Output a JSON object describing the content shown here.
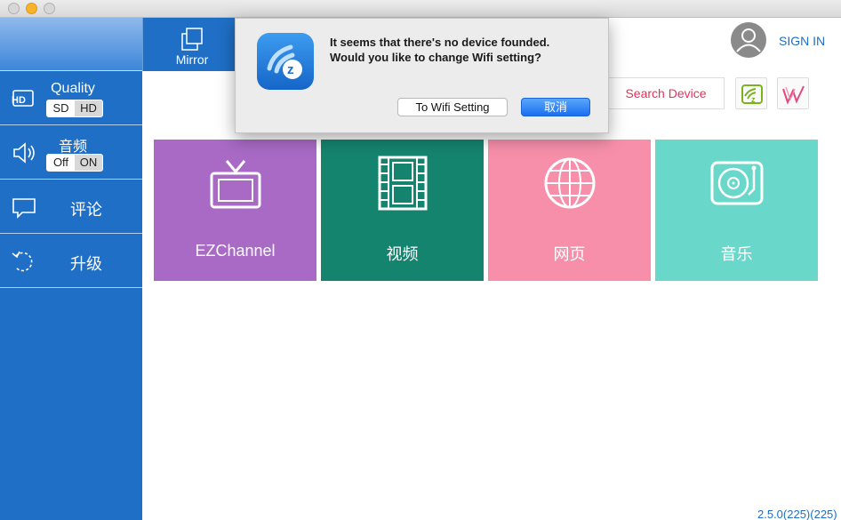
{
  "sidebar": {
    "quality": {
      "title": "Quality",
      "options": [
        "SD",
        "HD"
      ],
      "selected": "HD"
    },
    "audio": {
      "title": "音频",
      "options": [
        "Off",
        "ON"
      ],
      "selected": "ON"
    },
    "comment_label": "评论",
    "upgrade_label": "升级"
  },
  "mirror_label": "Mirror",
  "header": {
    "sign_in": "SIGN IN",
    "search_device": "Search Device"
  },
  "tiles": [
    {
      "label": "EZChannel",
      "icon": "tv-icon",
      "color": "#a86ac5"
    },
    {
      "label": "视频",
      "icon": "film-icon",
      "color": "#15846f"
    },
    {
      "label": "网页",
      "icon": "globe-icon",
      "color": "#f78fab"
    },
    {
      "label": "音乐",
      "icon": "turntable-icon",
      "color": "#69d8cb"
    }
  ],
  "version": "2.5.0(225)(225)",
  "dialog": {
    "line1": "It seems that there's no device founded.",
    "line2": "Would you like to change Wifi setting?",
    "secondary_button": "To Wifi Setting",
    "primary_button": "取消"
  },
  "colors": {
    "sidebar": "#1f6fc6",
    "accent": "#e2335a"
  }
}
